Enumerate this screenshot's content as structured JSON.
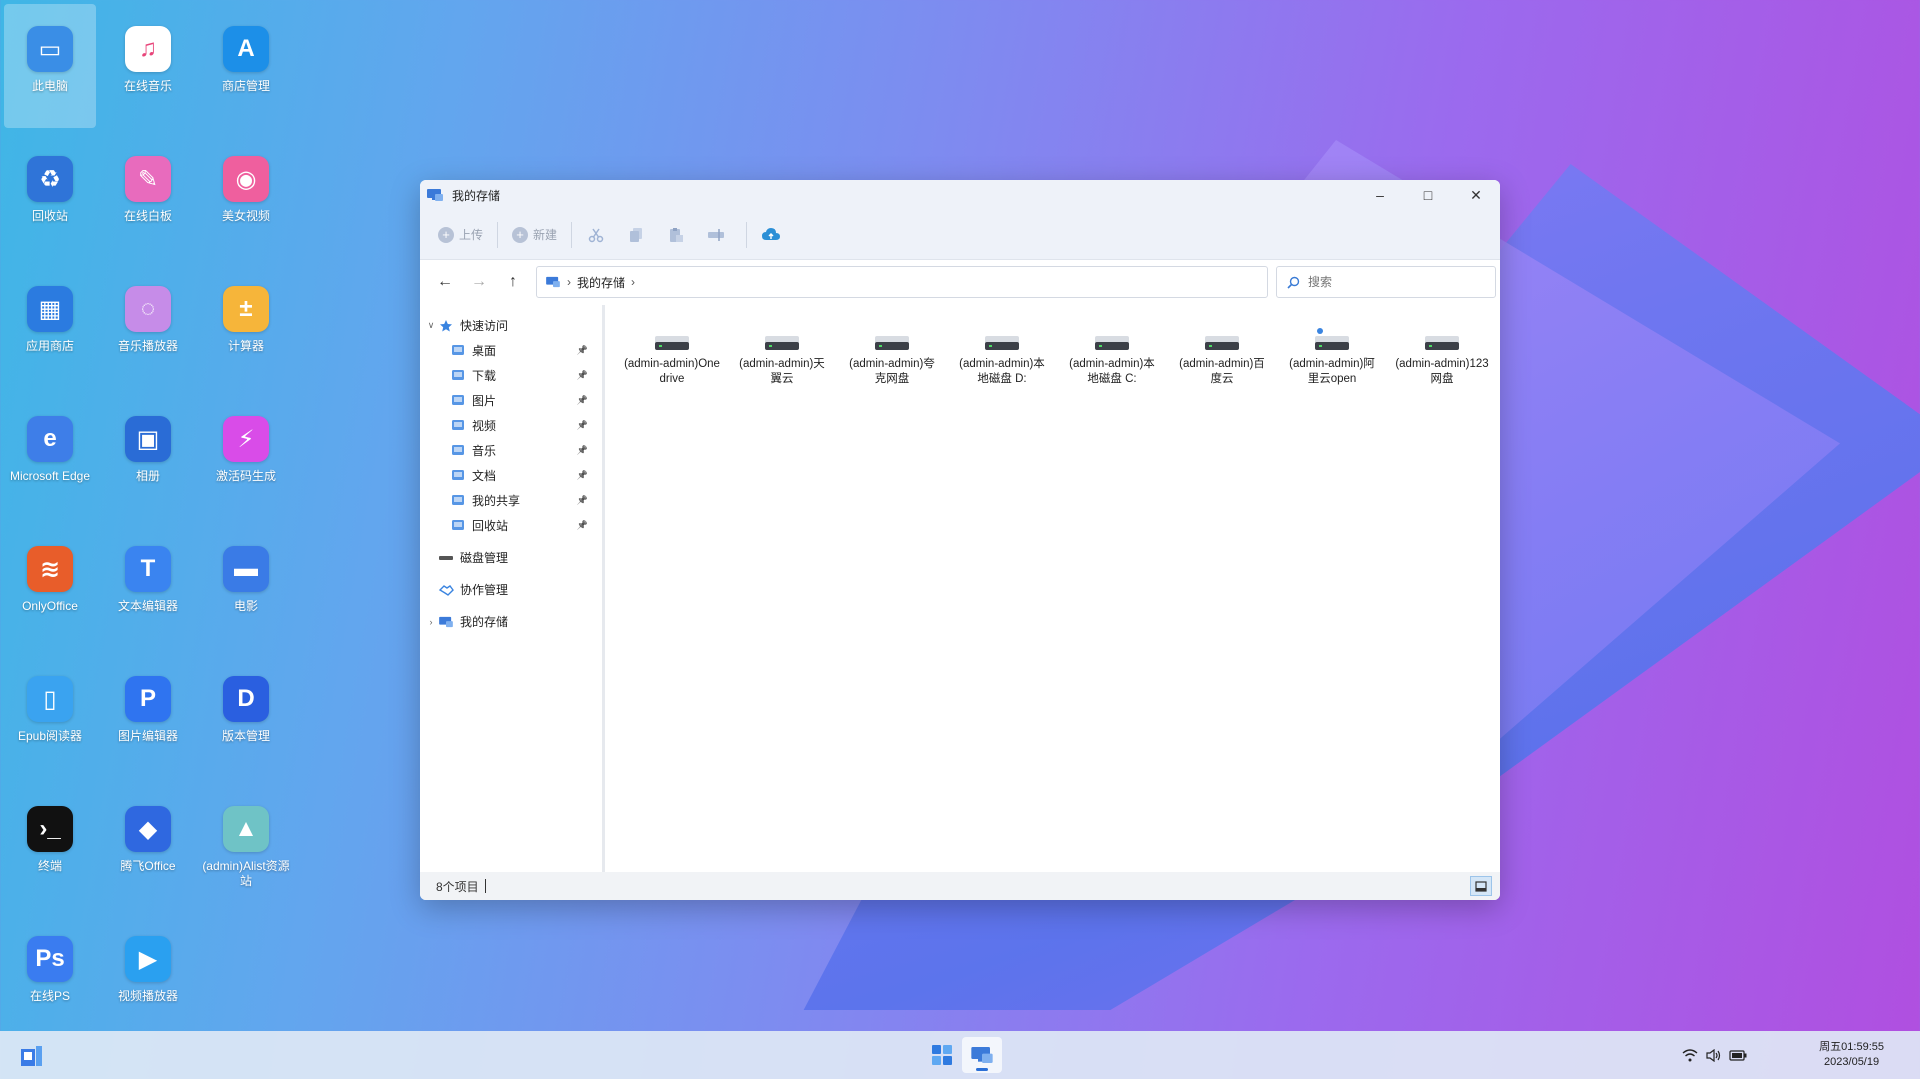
{
  "desktop": {
    "icons": [
      {
        "label": "此电脑",
        "icon": "computer-icon",
        "color": "#3a8ee6"
      },
      {
        "label": "在线音乐",
        "icon": "music-icon",
        "color": "#ffffff"
      },
      {
        "label": "商店管理",
        "icon": "store-manage-icon",
        "color": "#1c8fe8"
      },
      {
        "label": "回收站",
        "icon": "recycle-bin-icon",
        "color": "#2f74d8"
      },
      {
        "label": "在线白板",
        "icon": "whiteboard-icon",
        "color": "#e86bbd"
      },
      {
        "label": "美女视频",
        "icon": "video-icon",
        "color": "#ef5f9e"
      },
      {
        "label": "应用商店",
        "icon": "app-store-icon",
        "color": "#2b7be0"
      },
      {
        "label": "音乐播放器",
        "icon": "music-player-icon",
        "color": "#c68ce8"
      },
      {
        "label": "计算器",
        "icon": "calculator-icon",
        "color": "#f6b53a"
      },
      {
        "label": "Microsoft Edge",
        "icon": "edge-icon",
        "color": "#3e7ee8"
      },
      {
        "label": "相册",
        "icon": "album-icon",
        "color": "#2a6cd6"
      },
      {
        "label": "激活码生成",
        "icon": "activation-icon",
        "color": "#d94ce8"
      },
      {
        "label": "OnlyOffice",
        "icon": "onlyoffice-icon",
        "color": "#e85d2a"
      },
      {
        "label": "文本编辑器",
        "icon": "text-editor-icon",
        "color": "#3a84f0"
      },
      {
        "label": "电影",
        "icon": "folder-icon",
        "color": "#3a7be6"
      },
      {
        "label": "Epub阅读器",
        "icon": "epub-reader-icon",
        "color": "#3aa3f0"
      },
      {
        "label": "图片编辑器",
        "icon": "image-editor-icon",
        "color": "#2f74f0"
      },
      {
        "label": "版本管理",
        "icon": "version-icon",
        "color": "#2a5fe0"
      },
      {
        "label": "终端",
        "icon": "terminal-icon",
        "color": "#111111"
      },
      {
        "label": "腾飞Office",
        "icon": "office-icon",
        "color": "#2f68e0"
      },
      {
        "label": "(admin)Alist资源站",
        "icon": "alist-icon",
        "color": "#6fc3c6"
      },
      {
        "label": "在线PS",
        "icon": "photoshop-icon",
        "color": "#3a7cf0"
      },
      {
        "label": "视频播放器",
        "icon": "video-player-icon",
        "color": "#2aa0f0"
      }
    ]
  },
  "window": {
    "title": "我的存储",
    "toolbar": {
      "upload": "上传",
      "new": "新建"
    },
    "address": {
      "segments": [
        "我的存储"
      ]
    },
    "search": {
      "placeholder": "搜索"
    },
    "sidebar": {
      "quick_access": "快速访问",
      "items": [
        {
          "label": "桌面",
          "icon": "desktop-icon"
        },
        {
          "label": "下载",
          "icon": "download-icon"
        },
        {
          "label": "图片",
          "icon": "pictures-icon"
        },
        {
          "label": "视频",
          "icon": "videos-icon"
        },
        {
          "label": "音乐",
          "icon": "music-note-icon"
        },
        {
          "label": "文档",
          "icon": "documents-icon"
        },
        {
          "label": "我的共享",
          "icon": "share-icon"
        },
        {
          "label": "回收站",
          "icon": "recycle-bin-icon"
        }
      ],
      "disk_manage": "磁盘管理",
      "collab_manage": "协作管理",
      "my_storage": "我的存储"
    },
    "drives": [
      {
        "label": "(admin-admin)Onedrive",
        "shared": false
      },
      {
        "label": "(admin-admin)天翼云",
        "shared": false
      },
      {
        "label": "(admin-admin)夸克网盘",
        "shared": false
      },
      {
        "label": "(admin-admin)本地磁盘 D:",
        "shared": false
      },
      {
        "label": "(admin-admin)本地磁盘 C:",
        "shared": false
      },
      {
        "label": "(admin-admin)百度云",
        "shared": false
      },
      {
        "label": "(admin-admin)阿里云open",
        "shared": true
      },
      {
        "label": "(admin-admin)123网盘",
        "shared": false
      }
    ],
    "status": {
      "count": "8个项目"
    }
  },
  "taskbar": {
    "clock": {
      "time": "周五01:59:55",
      "date": "2023/05/19"
    }
  }
}
